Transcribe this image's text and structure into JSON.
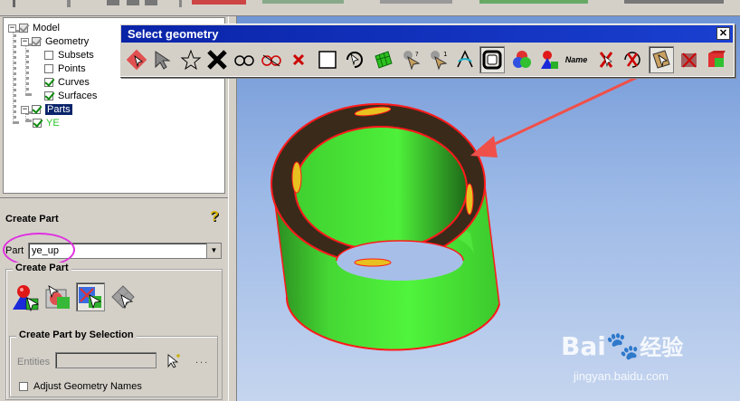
{
  "tree": {
    "items": [
      {
        "label": "Model"
      },
      {
        "label": "Geometry"
      },
      {
        "label": "Subsets"
      },
      {
        "label": "Points"
      },
      {
        "label": "Curves"
      },
      {
        "label": "Surfaces"
      },
      {
        "label": "Parts"
      },
      {
        "label": "YE"
      }
    ]
  },
  "panel": {
    "title": "Create Part",
    "part_label": "Part",
    "part_value": "ye_up",
    "create_group_title": "Create Part",
    "selection_group_title": "Create Part by Selection",
    "entities_label": "Entities",
    "entities_more": "...",
    "adjust_label": "Adjust Geometry Names"
  },
  "select_geometry": {
    "title": "Select geometry",
    "close": "✕",
    "name_button": "Name"
  },
  "watermark": {
    "brand": "Bai",
    "brand_cjk": "经验",
    "url": "jingyan.baidu.com"
  },
  "colors": {
    "tube_green": "#4cf23a",
    "tube_outline": "#ff1a1a",
    "tube_rim": "#3a2a1a",
    "highlight": "#e030e0",
    "arrow": "#f0504a",
    "titlebar": "#0a24a8"
  }
}
